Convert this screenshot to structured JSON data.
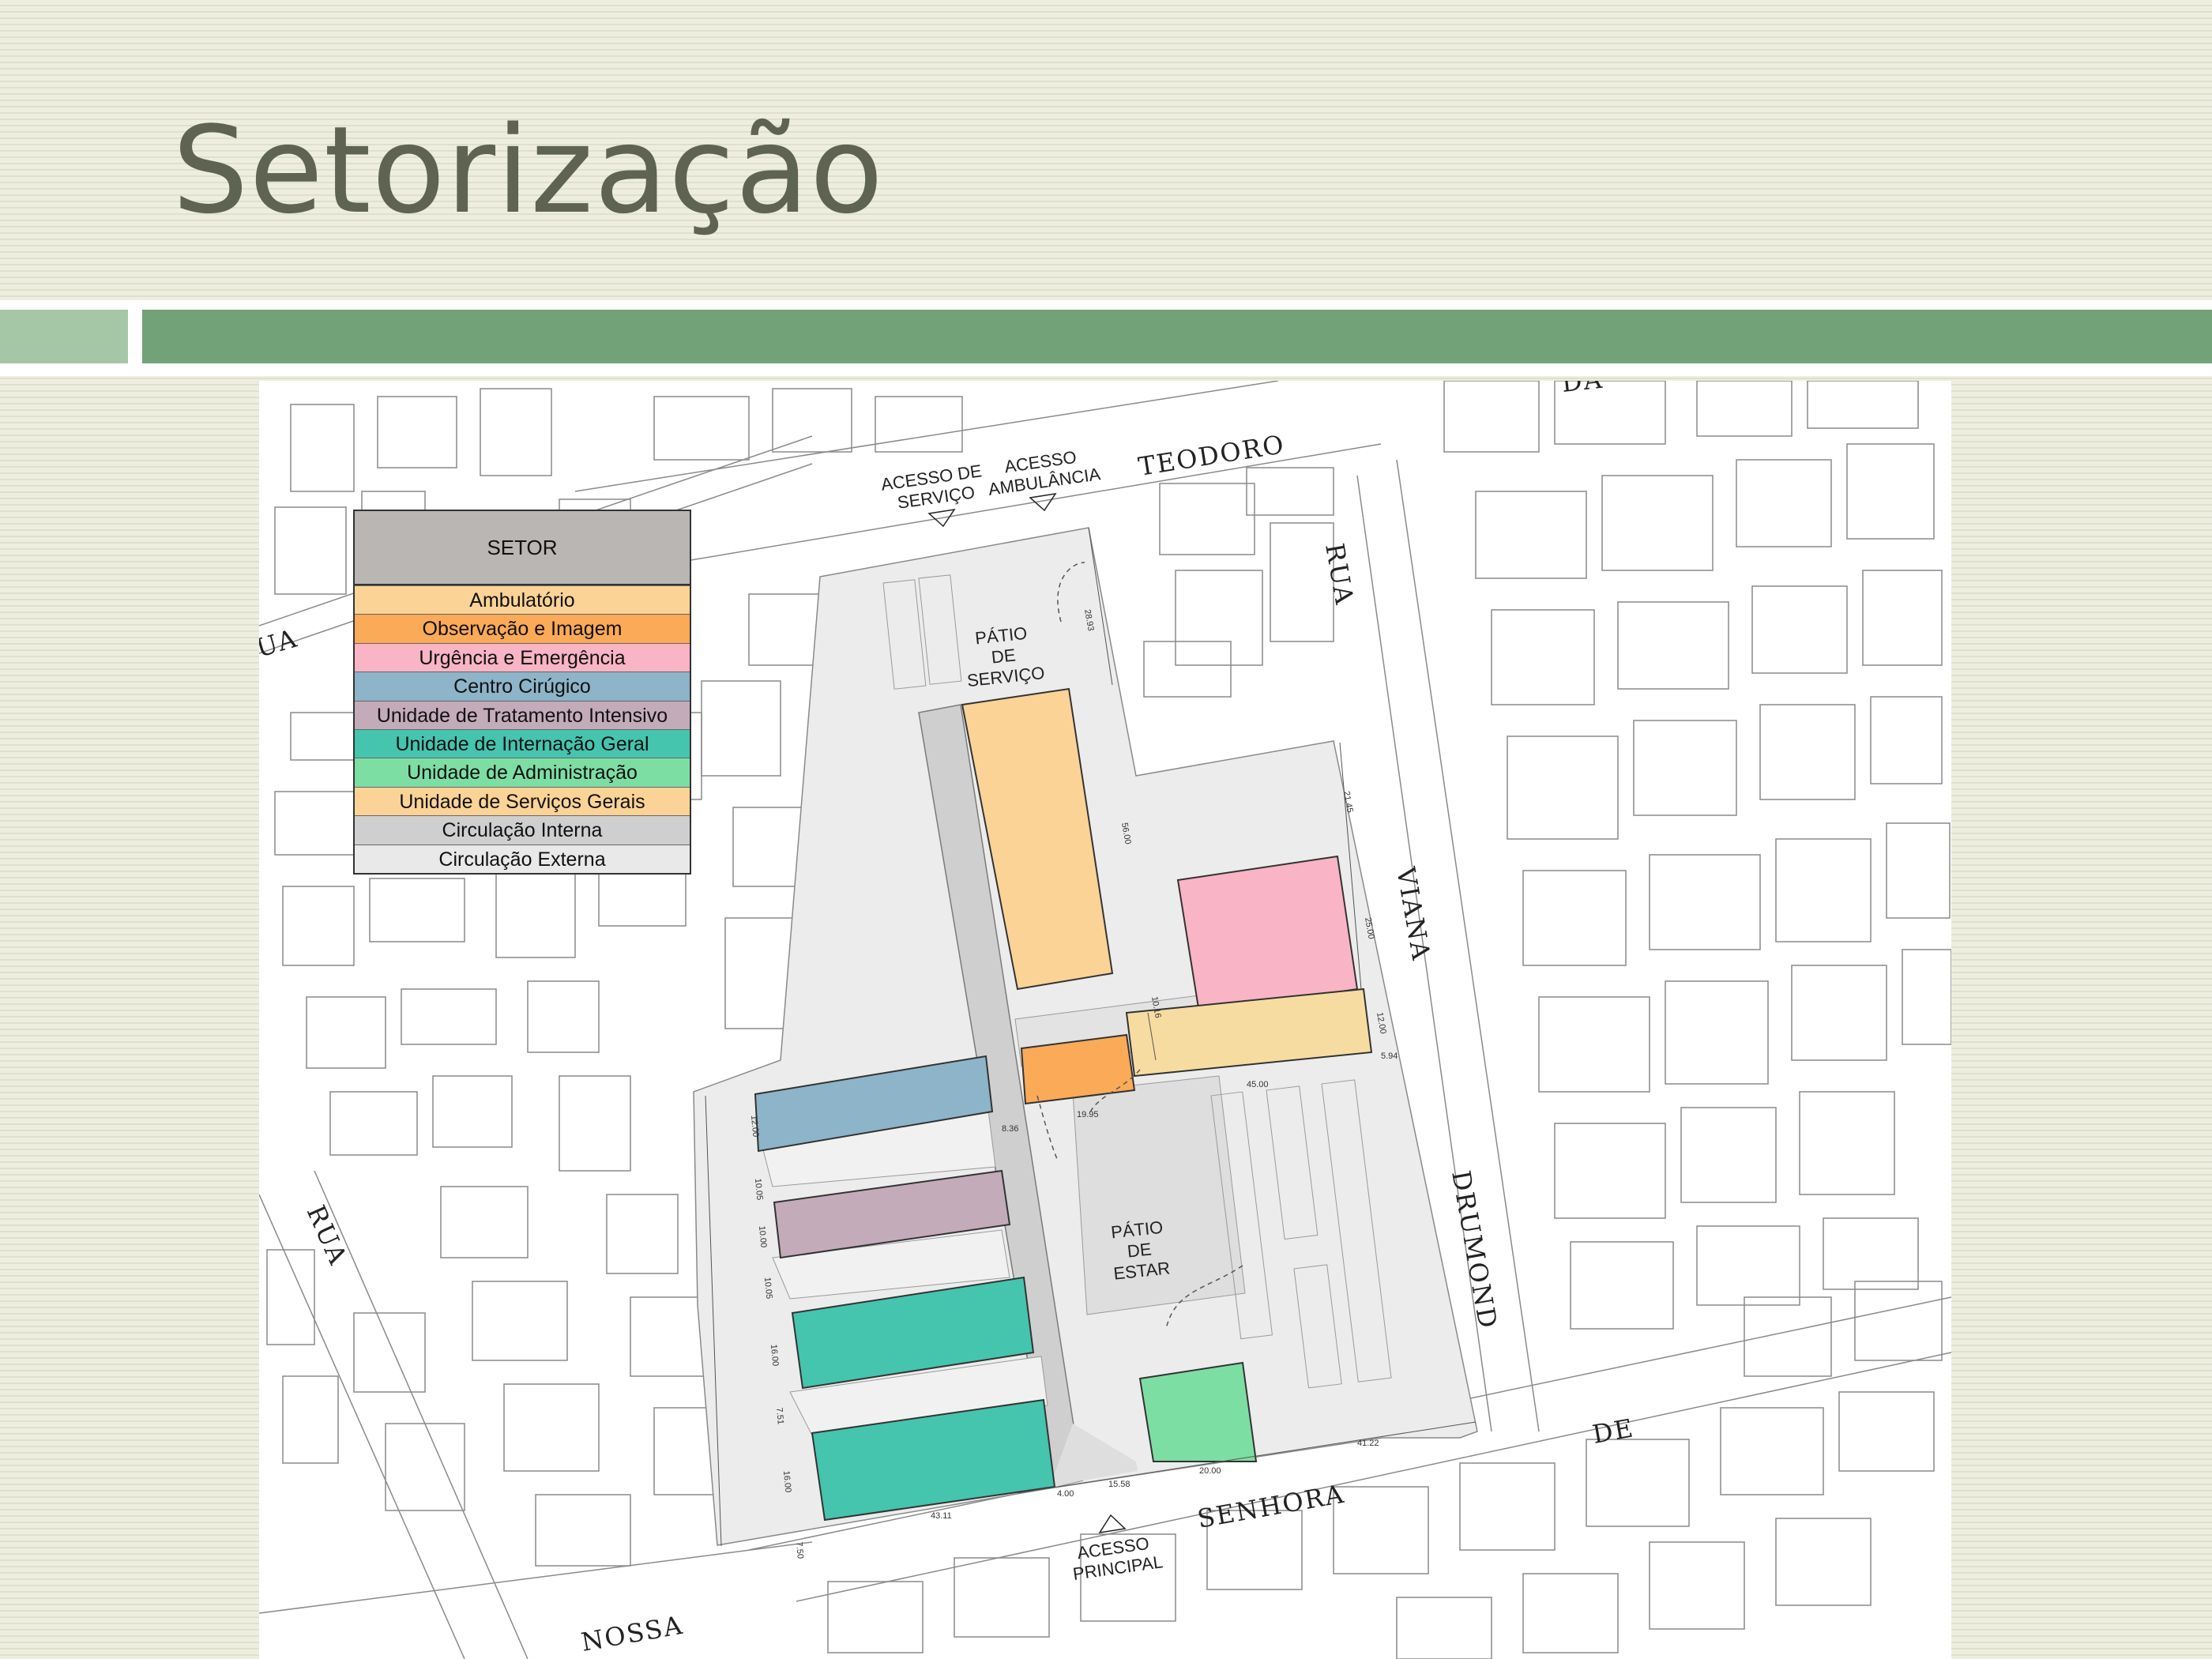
{
  "slide": {
    "title": "Setorização"
  },
  "legend": {
    "header": "SETOR",
    "items": [
      {
        "label": "Ambulatório",
        "color": "#fbd397"
      },
      {
        "label": "Observação e Imagem",
        "color": "#fbaa57"
      },
      {
        "label": "Urgência e Emergência",
        "color": "#f9b4c6"
      },
      {
        "label": "Centro Cirúgico",
        "color": "#8db4c8"
      },
      {
        "label": "Unidade de Tratamento Intensivo",
        "color": "#c4abba"
      },
      {
        "label": "Unidade de Internação Geral",
        "color": "#45c4ae"
      },
      {
        "label": "Unidade de Administração",
        "color": "#7ddea4"
      },
      {
        "label": "Unidade de Serviços Gerais",
        "color": "#fbd397"
      },
      {
        "label": "Circulação Interna",
        "color": "#cfcfcf"
      },
      {
        "label": "Circulação Externa",
        "color": "#e9e9e9"
      }
    ]
  },
  "streets": {
    "teodoro": "TEODORO",
    "rua_right": "RUA",
    "viana": "VIANA",
    "drumond": "DRUMOND",
    "de": "DE",
    "senhora": "SENHORA",
    "nossa": "NOSSA",
    "rua_left": "RUA",
    "ua_partial": "UA",
    "da_partial": "DA"
  },
  "access": {
    "servico_line1": "ACESSO DE",
    "servico_line2": "SERVIÇO",
    "ambulancia_line1": "ACESSO",
    "ambulancia_line2": "AMBULÂNCIA",
    "principal_line1": "ACESSO",
    "principal_line2": "PRINCIPAL"
  },
  "patios": {
    "servico": [
      "PÁTIO",
      "DE",
      "SERVIÇO"
    ],
    "estar": [
      "PÁTIO",
      "DE",
      "ESTAR"
    ]
  },
  "dimensions": {
    "d1": "28.93",
    "d2": "56.00",
    "d3": "21.45",
    "d4": "25.00",
    "d5": "12.00",
    "d6": "10.16",
    "d7": "5.94",
    "d8": "45.00",
    "d9": "19.95",
    "d10": "8.36",
    "d11": "12.00",
    "d12": "10.05",
    "d13": "10.00",
    "d14": "10.05",
    "d15": "16.00",
    "d16": "7.51",
    "d17": "16.00",
    "d18": "43.11",
    "d19": "4.00",
    "d20": "15.58",
    "d21": "20.00",
    "d22": "41.22",
    "d23": "7.50"
  }
}
